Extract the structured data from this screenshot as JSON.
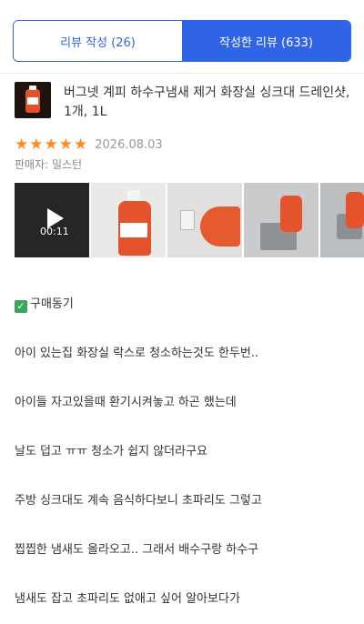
{
  "tabs": {
    "review_write": "리뷰 작성 (26)",
    "written_reviews": "작성한 리뷰 (633)"
  },
  "product": {
    "title": "버그넷 계피 하수구냄새 제거 화장실 싱크대 드레인샷, 1개, 1L",
    "thumbnail_icon": "product-bottle-image"
  },
  "review": {
    "rating": 5,
    "stars": [
      "★",
      "★",
      "★",
      "★",
      "★"
    ],
    "date": "2026.08.03",
    "seller": "판매자: 밀스턴",
    "photos": [
      {
        "type": "video",
        "duration": "00:11"
      },
      {
        "type": "image"
      },
      {
        "type": "image"
      },
      {
        "type": "image"
      },
      {
        "type": "image"
      }
    ],
    "check_icon": "✓",
    "heading": "구매동기",
    "lines": [
      "아이 있는집 화장실 락스로 청소하는것도 한두번..",
      "아이들 자고있을때 환기시켜놓고 하곤 했는데",
      "날도 덥고 ㅠㅠ 청소가 쉽지 않더라구요",
      "주방 싱크대도 계속 음식하다보니 초파리도 그렇고",
      "찝찝한 냄새도 올라오고.. 그래서 배수구랑 하수구",
      "냄새도 잡고 초파리도 없애고 싶어 알아보다가"
    ]
  },
  "colors": {
    "accent": "#2f64e6",
    "star": "#ff8a26",
    "check": "#3ba55c"
  }
}
